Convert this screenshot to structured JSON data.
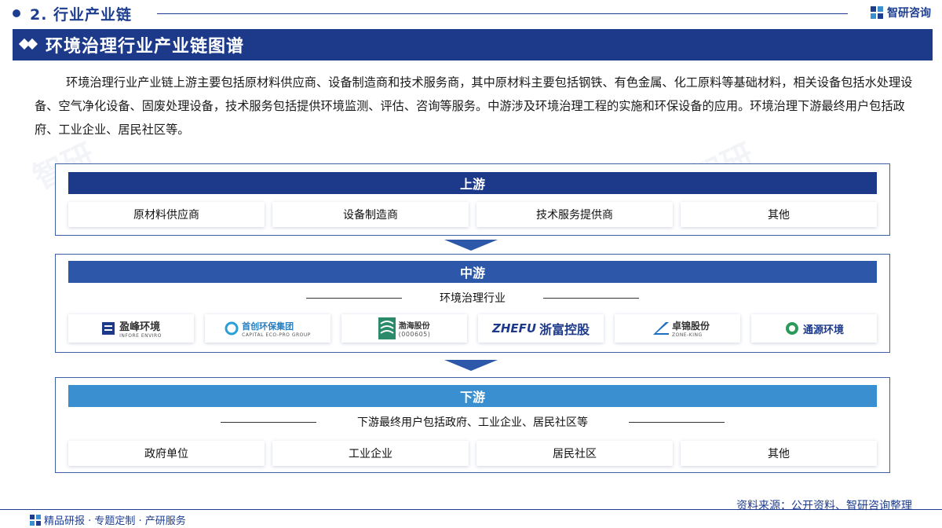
{
  "header": {
    "section_title": "2. 行业产业链",
    "brand_name": "智研咨询"
  },
  "banner": {
    "title": "环境治理行业产业链图谱"
  },
  "intro": "环境治理行业产业链上游主要包括原材料供应商、设备制造商和技术服务商，其中原材料主要包括钢铁、有色金属、化工原料等基础材料，相关设备包括水处理设备、空气净化设备、固废处理设备，技术服务包括提供环境监测、评估、咨询等服务。中游涉及环境治理工程的实施和环保设备的应用。环境治理下游最终用户包括政府、工业企业、居民社区等。",
  "upstream": {
    "title": "上游",
    "items": [
      "原材料供应商",
      "设备制造商",
      "技术服务提供商",
      "其他"
    ]
  },
  "midstream": {
    "title": "中游",
    "subtitle": "环境治理行业",
    "companies": [
      {
        "name": "盈峰环境",
        "sub": "INFORE ENVIRO"
      },
      {
        "name": "首创环保集团",
        "sub": "CAPITAL ECO-PRO GROUP"
      },
      {
        "name": "渤海股份",
        "sub": "(000605)"
      },
      {
        "name": "浙富控股",
        "sub": "ZHEFU"
      },
      {
        "name": "卓锦股份",
        "sub": "ZONE-KING"
      },
      {
        "name": "通源环境",
        "sub": ""
      }
    ]
  },
  "downstream": {
    "title": "下游",
    "subtitle": "下游最终用户包括政府、工业企业、居民社区等",
    "items": [
      "政府单位",
      "工业企业",
      "居民社区",
      "其他"
    ]
  },
  "footer": {
    "source": "资料来源：公开资料、智研咨询整理",
    "tagline": "精品研报 · 专题定制 · 产研服务"
  },
  "colors": {
    "primary": "#1d3a8a",
    "mid": "#2d57a8",
    "down": "#3a8fd0"
  }
}
